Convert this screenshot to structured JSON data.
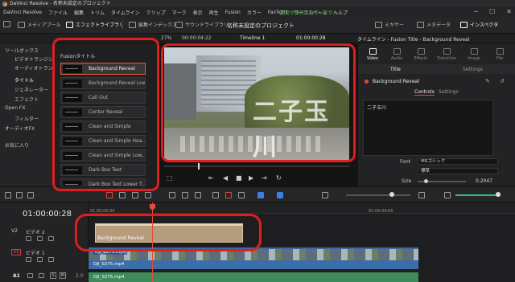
{
  "window": {
    "title": "DaVinci Resolve - 名称未設定のプロジェクト",
    "controls": [
      "─",
      "☐",
      "✕"
    ]
  },
  "menu": {
    "items": [
      "DaVinci Resolve",
      "ファイル",
      "編集",
      "トリム",
      "タイムライン",
      "クリップ",
      "マーク",
      "表示",
      "再生",
      "Fusion",
      "カラー",
      "Fairlight",
      "ワークスペース",
      "ヘルプ"
    ],
    "saved_status": "変更が保存されていません"
  },
  "toolbar": {
    "media_pool": "メディアプール",
    "effects_library": "エフェクトライブラリ",
    "edit_index": "編集インデックス",
    "sound_library": "サウンドライブラリ",
    "project_title": "名称未設定のプロジェクト",
    "mixer": "ミキサー",
    "metadata": "メタデータ",
    "inspector": "インスペクタ"
  },
  "subbar": {
    "zoom": "27%",
    "source_tc": "00:00:04:22",
    "timeline_name": "Timeline 1",
    "timeline_tc": "01:00:00:28",
    "inspector_title": "タイムライン - Fusion Title - Background Reveal"
  },
  "left_panel": {
    "items": [
      {
        "label": "ツールボックス",
        "sub": false
      },
      {
        "label": "ビデオトランジション",
        "sub": true
      },
      {
        "label": "オーディオトランジション",
        "sub": true
      },
      {
        "label": "タイトル",
        "sub": true
      },
      {
        "label": "ジェネレーター",
        "sub": true
      },
      {
        "label": "エフェクト",
        "sub": true
      },
      {
        "label": "Open FX",
        "sub": false
      },
      {
        "label": "フィルター",
        "sub": true
      },
      {
        "label": "オーディオFX",
        "sub": false
      },
      {
        "label": "お気に入り",
        "sub": false
      }
    ]
  },
  "fusion_titles": {
    "header": "Fusionタイトル",
    "items": [
      "Background Reveal",
      "Background Reveal Low...",
      "Call Out",
      "Center Reveal",
      "Clean and Simple",
      "Clean and Simple Hea...",
      "Clean and Simple Low...",
      "Dark Box Text",
      "Dark Box Text Lower T..."
    ],
    "selected": 0
  },
  "viewer": {
    "overlay_text": "二子玉川",
    "controls": [
      "⇤",
      "◀",
      "■",
      "▶",
      "⇥",
      "↻"
    ]
  },
  "inspector": {
    "tabs": [
      "Video",
      "Audio",
      "Effects",
      "Transition",
      "Image",
      "File"
    ],
    "active_tab": "Video",
    "subtabs": [
      "Title",
      "Settings"
    ],
    "clip_name": "Background Reveal",
    "control_tabs": [
      "Controls",
      "Settings"
    ],
    "text_value": "二子玉川",
    "font_label": "Font",
    "font_value": "MSゴシック",
    "style_value": "標準",
    "size_label": "Size",
    "size_value": "0.2047"
  },
  "timeline": {
    "timecode": "01:00:00:28",
    "ruler_ticks": [
      "01:00:00:00",
      "01:00:04:00"
    ],
    "tracks": [
      {
        "id": "V2",
        "name": "ビデオ 2"
      },
      {
        "id": "V1",
        "name": "ビデオ 1"
      },
      {
        "id": "A1",
        "name": "",
        "level": "2.0"
      }
    ],
    "title_clip": "Background Reveal",
    "video_clip": "DJI_0275.mp4",
    "audio_clip": "DJI_0275.mp4"
  }
}
